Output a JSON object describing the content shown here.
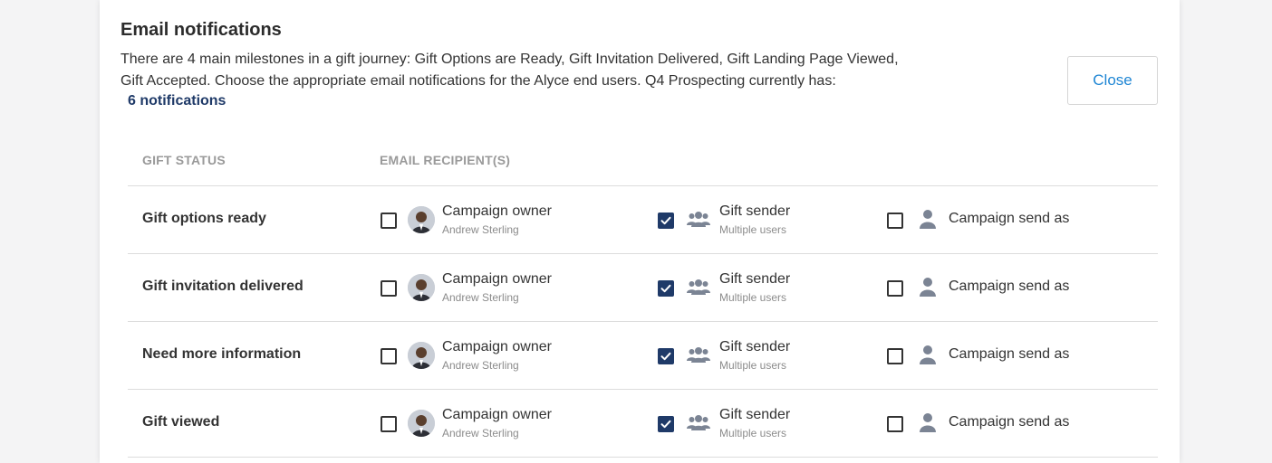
{
  "header": {
    "title": "Email notifications",
    "description": "There are 4 main milestones in a gift journey: Gift Options are Ready, Gift Invitation Delivered, Gift Landing Page Viewed, Gift Accepted. Choose the appropriate email notifications for the Alyce end users. Q4 Prospecting currently has:",
    "notification_count": "6 notifications",
    "close_label": "Close"
  },
  "table": {
    "columns": [
      "GIFT STATUS",
      "EMAIL RECIPIENT(S)"
    ],
    "recipients": {
      "owner": {
        "label": "Campaign owner",
        "sub": "Andrew Sterling"
      },
      "sender": {
        "label": "Gift sender",
        "sub": "Multiple users"
      },
      "send_as": {
        "label": "Campaign send as"
      }
    },
    "rows": [
      {
        "status": "Gift options ready",
        "owner_checked": false,
        "sender_checked": true,
        "send_as_checked": false
      },
      {
        "status": "Gift invitation delivered",
        "owner_checked": false,
        "sender_checked": true,
        "send_as_checked": false
      },
      {
        "status": "Need more information",
        "owner_checked": false,
        "sender_checked": true,
        "send_as_checked": false
      },
      {
        "status": "Gift viewed",
        "owner_checked": false,
        "sender_checked": true,
        "send_as_checked": false
      }
    ]
  },
  "colors": {
    "accent": "#1f3a68",
    "link": "#1f86d4",
    "icon": "#7b8494"
  }
}
